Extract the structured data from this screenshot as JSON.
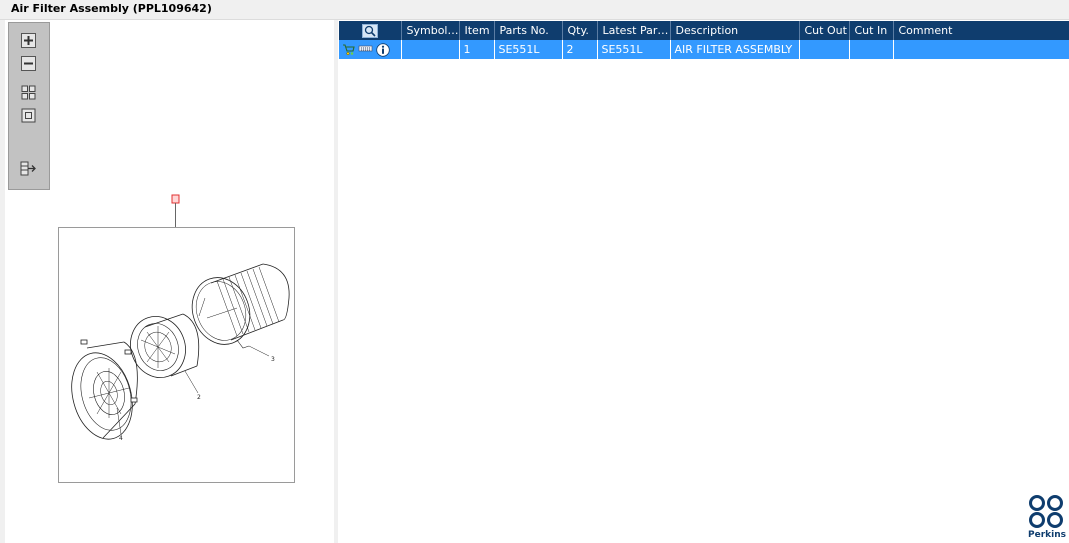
{
  "window": {
    "title": "Air Filter Assembly (PPL109642)"
  },
  "viewer": {
    "toolbox": {
      "zoom_in": "zoom-in-icon",
      "zoom_out": "zoom-out-icon",
      "fit_all": "fit-all-icon",
      "actual_size": "actual-size-icon",
      "export": "export-icon"
    },
    "hotspot_label": "",
    "callouts": [
      "2",
      "3",
      "4"
    ]
  },
  "grid": {
    "columns": [
      "",
      "Symbol(s)",
      "Item",
      "Parts No.",
      "Qty.",
      "Latest Part...",
      "Description",
      "Cut Out",
      "Cut In",
      "Comment"
    ],
    "rows": [
      {
        "icons": [
          "cart-icon",
          "keyboard-icon",
          "info-icon"
        ],
        "symbols": "",
        "item": "1",
        "part_no": "SE551L",
        "qty": "2",
        "latest_part": "SE551L",
        "description": "AIR FILTER ASSEMBLY",
        "cut_out": "",
        "cut_in": "",
        "comment": ""
      }
    ]
  },
  "brand": {
    "name": "Perkins",
    "color": "#0f3d6e"
  },
  "colors": {
    "header_bg": "#0f3d6e",
    "selected_row": "#3399ff"
  }
}
